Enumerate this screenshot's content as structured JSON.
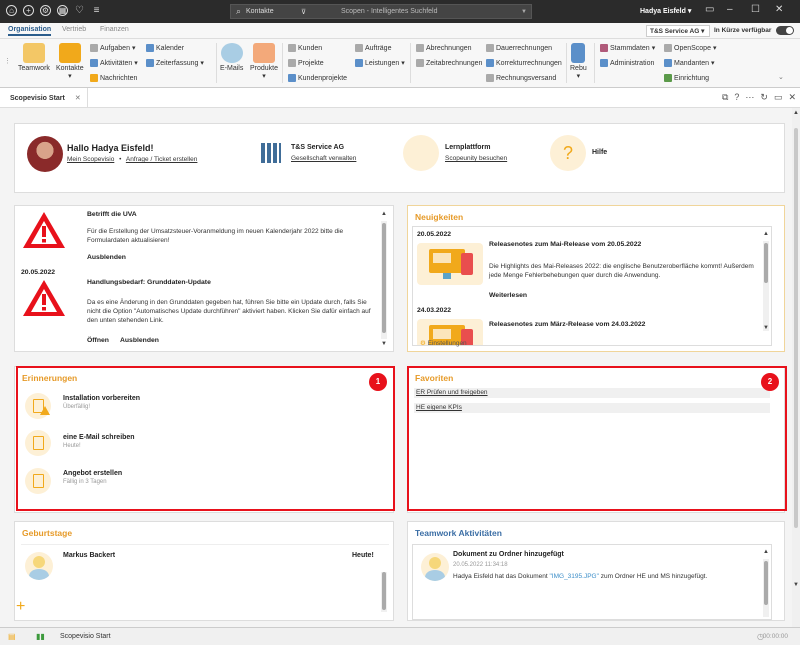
{
  "titlebar": {
    "search_scope": "Kontakte",
    "search_placeholder": "Scopen - Intelligentes Suchfeld",
    "user": "Hadya Eisfeld"
  },
  "ribbon_tabs": [
    "Organisation",
    "Vertrieb",
    "Finanzen"
  ],
  "company_select": "T&S Service AG",
  "availability": "In Kürze verfügbar",
  "ribbon": {
    "teamwork": "Teamwork",
    "kontakte": "Kontakte",
    "aufgaben": "Aufgaben",
    "kalender": "Kalender",
    "aktivitaeten": "Aktivitäten",
    "zeiterfassung": "Zeiterfassung",
    "nachrichten": "Nachrichten",
    "emails": "E-Mails",
    "produkte": "Produkte",
    "kunden": "Kunden",
    "auftraege": "Aufträge",
    "projekte": "Projekte",
    "leistungen": "Leistungen",
    "kundenprojekte": "Kundenprojekte",
    "abrechnungen": "Abrechnungen",
    "dauerrechnungen": "Dauerrechnungen",
    "zeitabrechnungen": "Zeitabrechnungen",
    "korrekturrechnungen": "Korrekturrechnungen",
    "rechnungsversand": "Rechnungsversand",
    "rebu": "Rebu",
    "stammdaten": "Stammdaten",
    "openscope": "OpenScope",
    "administration": "Administration",
    "mandanten": "Mandanten",
    "einrichtung": "Einrichtung"
  },
  "doc_tab": "Scopevisio Start",
  "welcome": {
    "hello": "Hallo Hadya Eisfeld!",
    "link1": "Mein Scopevisio",
    "sep": "•",
    "link2": "Anfrage / Ticket erstellen",
    "company_title": "T&S Service AG",
    "company_link": "Gesellschaft verwalten",
    "learn_title": "Lernplattform",
    "learn_link": "Scopeunity besuchen",
    "help_title": "Hilfe",
    "help_icon": "?"
  },
  "alerts": {
    "a1_title": "Betrifft die UVA",
    "a1_text": "Für die Erstellung der Umsatzsteuer-Voranmeldung im neuen Kalenderjahr 2022 bitte die Formulardaten aktualisieren!",
    "a1_link": "Ausblenden",
    "date": "20.05.2022",
    "a2_title": "Handlungsbedarf: Grunddaten-Update",
    "a2_text": "Da es eine Änderung in den Grunddaten gegeben hat, führen Sie bitte ein Update durch, falls Sie nicht die Option \"Automatisches Update durchführen\" aktiviert haben. Klicken Sie dafür einfach auf den unten stehenden Link.",
    "a2_link1": "Öffnen",
    "a2_link2": "Ausblenden"
  },
  "news": {
    "title": "Neuigkeiten",
    "date1": "20.05.2022",
    "n1_title": "Releasenotes zum Mai-Release vom 20.05.2022",
    "n1_text": "Die Highlights des Mai-Releases 2022: die englische Benutzeroberfläche kommt! Außerdem jede Menge Fehlerbehebungen quer durch die Anwendung.",
    "n1_link": "Weiterlesen",
    "date2": "24.03.2022",
    "n2_title": "Releasenotes zum März-Release vom 24.03.2022",
    "settings": "Einstellungen"
  },
  "reminders": {
    "title": "Erinnerungen",
    "items": [
      {
        "title": "Installation vorbereiten",
        "sub": "Überfällig!"
      },
      {
        "title": "eine E-Mail schreiben",
        "sub": "Heute!"
      },
      {
        "title": "Angebot erstellen",
        "sub": "Fällig in 3 Tagen"
      }
    ]
  },
  "favorites": {
    "title": "Favoriten",
    "items": [
      "ER Prüfen und freigeben",
      "HE eigene KPIs"
    ]
  },
  "badges": {
    "b1": "1",
    "b2": "2"
  },
  "birthdays": {
    "title": "Geburtstage",
    "name": "Markus Backert",
    "when": "Heute!"
  },
  "teamwork": {
    "title": "Teamwork Aktivitäten",
    "event": "Dokument zu Ordner hinzugefügt",
    "time": "20.05.2022 11:34:18",
    "text_pre": "Hadya Eisfeld hat das Dokument",
    "doc": "\"IMG_3195.JPG\"",
    "text_post": "zum Ordner HE und MS hinzugefügt."
  },
  "status": {
    "label": "Scopevisio Start",
    "time": "00:00:00"
  }
}
